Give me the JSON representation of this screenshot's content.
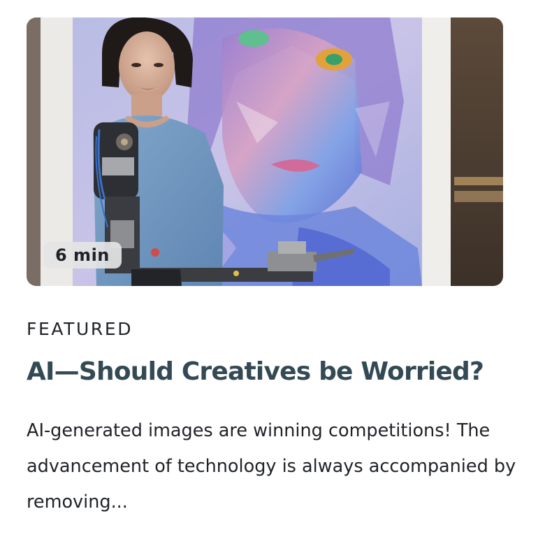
{
  "card": {
    "image": {
      "alt": "Humanoid robot with exposed mechanical arm standing in front of a colorful abstract self-portrait painting",
      "duration_label": "6 min"
    },
    "category": "FEATURED",
    "title": "AI—Should Creatives be Worried?",
    "excerpt": "AI-generated images are winning competitions! The advancement of technology is always accompanied by removing..."
  },
  "colors": {
    "title": "#334a55",
    "body_text": "#1f2227",
    "badge_bg": "#e4e4e4",
    "background": "#ffffff"
  }
}
